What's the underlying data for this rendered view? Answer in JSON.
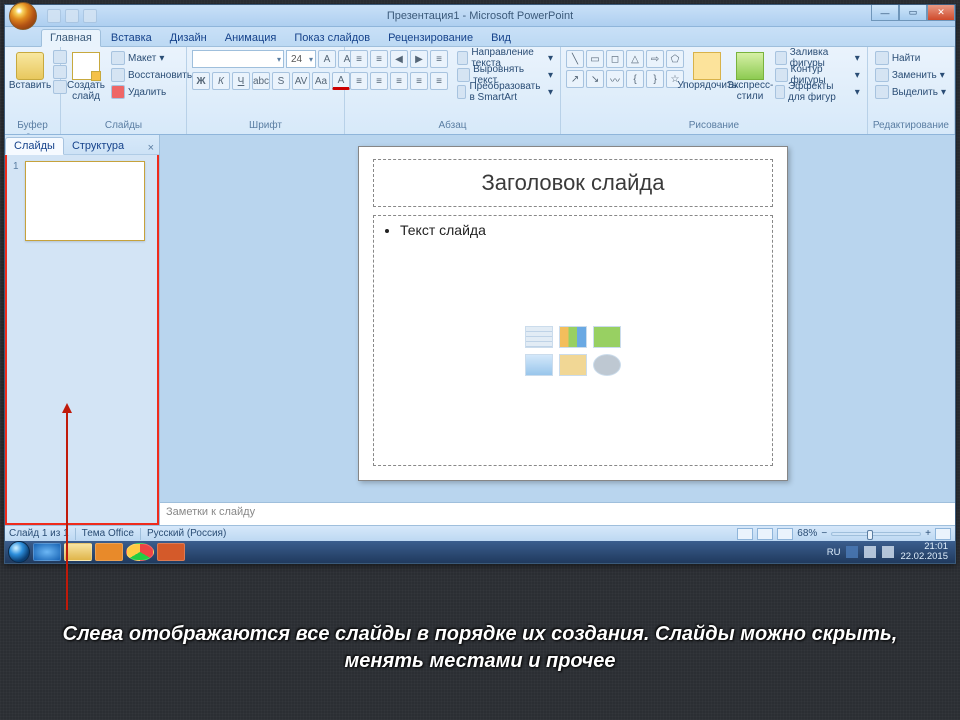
{
  "title": "Презентация1 - Microsoft PowerPoint",
  "tabs": {
    "home": "Главная",
    "insert": "Вставка",
    "design": "Дизайн",
    "animation": "Анимация",
    "slideshow": "Показ слайдов",
    "review": "Рецензирование",
    "view": "Вид"
  },
  "ribbon": {
    "clipboard": {
      "label": "Буфер о...",
      "paste": "Вставить"
    },
    "slides": {
      "label": "Слайды",
      "new": "Создать\nслайд",
      "layout": "Макет",
      "reset": "Восстановить",
      "delete": "Удалить"
    },
    "font": {
      "label": "Шрифт",
      "size": "24"
    },
    "paragraph": {
      "label": "Абзац",
      "direction": "Направление текста",
      "align": "Выровнять текст",
      "smartart": "Преобразовать в SmartArt"
    },
    "drawing": {
      "label": "Рисование",
      "arrange": "Упорядочить",
      "styles": "Экспресс-стили",
      "fill": "Заливка фигуры",
      "outline": "Контур фигуры",
      "effects": "Эффекты для фигур"
    },
    "editing": {
      "label": "Редактирование",
      "find": "Найти",
      "replace": "Заменить",
      "select": "Выделить"
    }
  },
  "side": {
    "slides": "Слайды",
    "outline": "Структура"
  },
  "slide": {
    "title": "Заголовок слайда",
    "body": "Текст слайда"
  },
  "notes_placeholder": "Заметки к слайду",
  "status": {
    "slideinfo": "Слайд 1 из 1",
    "theme": "Тема Office",
    "lang": "Русский (Россия)",
    "zoom": "68%"
  },
  "tray": {
    "lang": "RU",
    "time": "21:01",
    "date": "22.02.2015"
  },
  "caption": "Слева отображаются все слайды в порядке их создания. Слайды можно скрыть, менять местами и прочее"
}
